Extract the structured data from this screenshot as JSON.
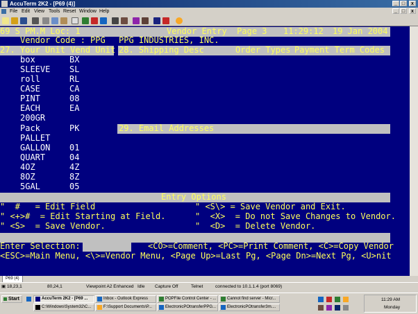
{
  "window": {
    "title": "AccuTerm 2K2 - [P69 (4)]",
    "min": "_",
    "max": "□",
    "close": "x"
  },
  "menu": [
    "File",
    "Edit",
    "View",
    "Tools",
    "Reset",
    "Window",
    "Help"
  ],
  "terminal": {
    "header": {
      "left": "69 S PM.M Loc: 1",
      "center": "Vendor Entry  Page 3",
      "time": "11:29:12",
      "date": "19 Jan 2004"
    },
    "vendor_code_label": "Vendor Code :",
    "vendor_code": "PPG",
    "vendor_name": "PPG INDUSTRIES, INC.",
    "col_headers": {
      "f27": "27. Your Unit Vend Unit",
      "f28": "28. Shipping Desc",
      "order_types": "Order Types",
      "payment": "Payment Term Codes"
    },
    "units": [
      {
        "unit": "box",
        "vend": "BX"
      },
      {
        "unit": "SLEEVE",
        "vend": "SL"
      },
      {
        "unit": "roll",
        "vend": "RL"
      },
      {
        "unit": "CASE",
        "vend": "CA"
      },
      {
        "unit": "PINT",
        "vend": "08"
      },
      {
        "unit": "EACH",
        "vend": "EA"
      },
      {
        "unit": "200GR",
        "vend": ""
      },
      {
        "unit": "Pack",
        "vend": "PK"
      },
      {
        "unit": "PALLET",
        "vend": ""
      },
      {
        "unit": "GALLON",
        "vend": "01"
      },
      {
        "unit": "QUART",
        "vend": "04"
      },
      {
        "unit": "4OZ",
        "vend": "4Z"
      },
      {
        "unit": "8OZ",
        "vend": "8Z"
      },
      {
        "unit": "5GAL",
        "vend": "05"
      }
    ],
    "email_header": "29. Email Addresses",
    "entry_options_title": "Entry Options",
    "options": [
      {
        "left": "\"  #   = Edit Field",
        "right": "\" <S\\> = Save Vendor and Exit."
      },
      {
        "left": "\" <+>#  = Edit Starting at Field.",
        "right": "\"  <X>  = Do not Save Changes to Vendor."
      },
      {
        "left": "\" <S>  = Save Vendor.",
        "right": "\"  <D>  = Delete Vendor."
      }
    ],
    "prompt_label": "Enter Selection:",
    "prompt_value": "",
    "cmd_line1": "<CO>=Comment, <PC>=Print Comment, <C>=Copy Vendor",
    "cmd_line2": "<ESC>=Main Menu, <\\>=Vendor Menu, <Page Up>=Last Pg, <Page Dn>=Next Pg, <U>nit"
  },
  "statusbar": {
    "pos1": "18,23,1",
    "pos2": "80,24,1",
    "emulation": "Viewpoint A2 Enhanced",
    "idle": "Idle",
    "capture": "Capture Off",
    "telnet": "Telnet",
    "connection": "connected to 10.1.1.4 (port 8069)"
  },
  "doc_tab": "P69 (4)",
  "taskbar": {
    "start": "Start",
    "tasks": [
      "AccuTerm 2K2 - [P69 ...",
      "Inbox - Outlook Express",
      "POPFile Control Center - ...",
      "Cannot find server - Micr...",
      "C:\\Windows\\System32\\C...",
      "F:\\Support Documents\\P...",
      "ElectronicPOtransferPPG...",
      "ElectronicPOtransfer3m...."
    ],
    "time": "11:29 AM",
    "day": "Monday"
  }
}
